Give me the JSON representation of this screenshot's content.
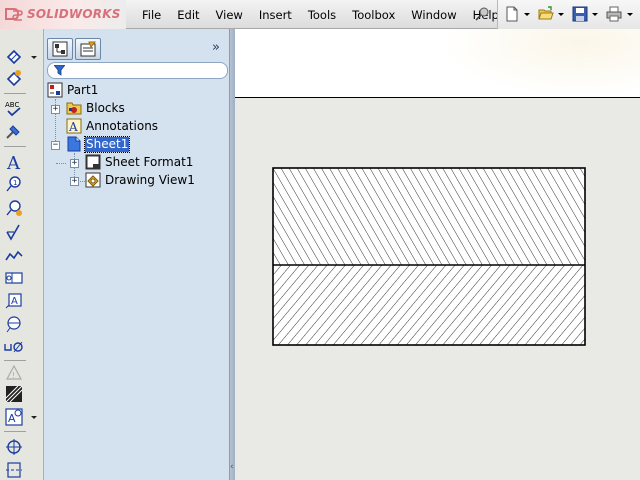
{
  "app": {
    "brand": "SOLIDWORKS",
    "brand_color": "#d8707a",
    "menu": [
      "File",
      "Edit",
      "View",
      "Insert",
      "Tools",
      "Toolbox",
      "Window",
      "Help"
    ],
    "quick_access_icons": [
      "new-document-icon",
      "open-folder-icon",
      "save-icon",
      "print-icon"
    ]
  },
  "left_toolbar": {
    "icons": [
      "smart-dimension-icon",
      "model-items-icon",
      "spell-check-icon",
      "format-painter-icon",
      "note-icon",
      "balloon-icon",
      "auto-balloon-icon",
      "surface-finish-icon",
      "weld-symbol-icon",
      "geometric-tolerance-icon",
      "datum-feature-icon",
      "datum-target-icon",
      "hole-callout-icon",
      "revision-symbol-icon",
      "area-hatch-icon",
      "block-icon",
      "center-mark-icon",
      "centerline-icon"
    ]
  },
  "feature_manager": {
    "tabs": [
      "featuremanager-tab",
      "propertymanager-tab"
    ],
    "expand_glyph": "»",
    "tree": {
      "root": "Part1",
      "items": [
        {
          "label": "Blocks",
          "icon": "blocks-folder-icon",
          "expander": "+"
        },
        {
          "label": "Annotations",
          "icon": "annotations-icon",
          "expander": ""
        },
        {
          "label": "Sheet1",
          "icon": "sheet-icon",
          "expander": "−",
          "selected": true
        },
        {
          "label": "Sheet Format1",
          "icon": "sheet-format-icon",
          "expander": "+"
        },
        {
          "label": "Drawing View1",
          "icon": "drawing-view-icon",
          "expander": "+"
        }
      ]
    }
  },
  "graphics": {
    "sheet_background": "#e9e9e5",
    "drawing_view": "section view with two hatched regions"
  }
}
